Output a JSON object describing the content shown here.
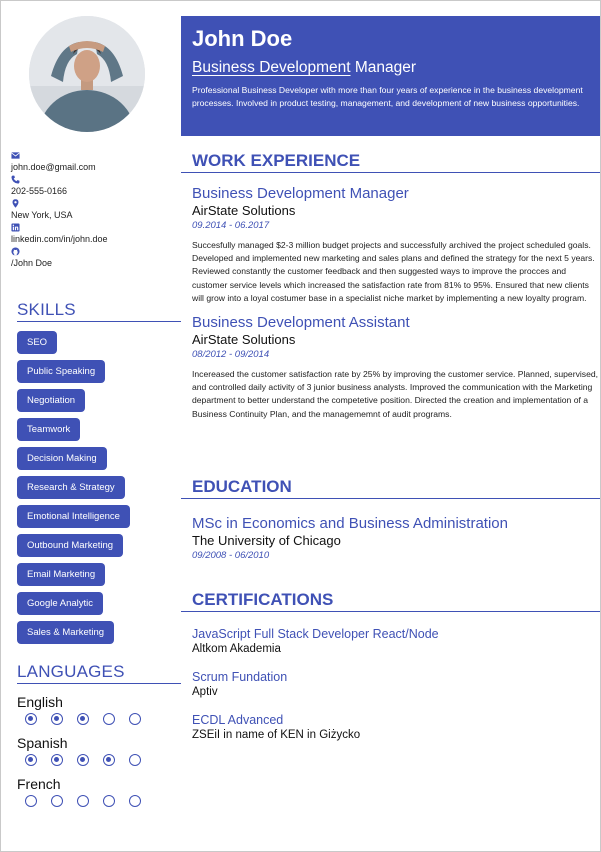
{
  "profile": {
    "name": "John Doe",
    "role_underlined": "Business Development",
    "role_rest": " Manager",
    "summary": "Professional Business Developer with more than four years of experience in the business development processes. Involved in product testing, management, and development of new business opportunities."
  },
  "contacts": [
    {
      "icon": "envelope-icon",
      "text": "john.doe@gmail.com"
    },
    {
      "icon": "phone-icon",
      "text": "202-555-0166"
    },
    {
      "icon": "location-pin-icon",
      "text": "New York, USA"
    },
    {
      "icon": "linkedin-icon",
      "text": "linkedin.com/in/john.doe"
    },
    {
      "icon": "github-icon",
      "text": "/John Doe"
    }
  ],
  "skills": {
    "heading": "SKILLS",
    "items": [
      "SEO",
      "Public Speaking",
      "Negotiation",
      "Teamwork",
      "Decision Making",
      "Research & Strategy",
      "Emotional Intelligence",
      "Outbound Marketing",
      "Email Marketing",
      "Google Analytic",
      "Sales & Marketing"
    ]
  },
  "languages": {
    "heading": "LANGUAGES",
    "items": [
      {
        "name": "English",
        "level": 3,
        "max": 5
      },
      {
        "name": "Spanish",
        "level": 4,
        "max": 5
      },
      {
        "name": "French",
        "level": 0,
        "max": 5
      }
    ]
  },
  "work": {
    "heading": "WORK EXPERIENCE",
    "jobs": [
      {
        "title": "Business Development Manager",
        "company": "AirState Solutions",
        "dates": "09.2014 - 06.2017",
        "description": "Succesfully managed $2-3 million budget projects and successfully archived the project scheduled goals. Developed and implemented new marketing and sales plans and defined the strategy for the next 5 years. Reviewed constantly the customer feedback and then suggested ways to improve the procces and customer service levels which increased the satisfaction rate from 81% to 95%. Ensured that new clients will grow into a loyal costumer base in a specialist niche market by implementing a new loyalty program."
      },
      {
        "title": "Business Development Assistant",
        "company": "AirState Solutions",
        "dates": "08/2012 - 09/2014",
        "description": "Incereased the customer satisfaction rate by 25% by improving the customer service. Planned, supervised, and controlled daily activity of 3 junior business analysts. Improved the communication with the Marketing department to better understand the competetive position. Directed the creation and implementation of a Business Continuity Plan, and the managememnt of audit programs."
      }
    ]
  },
  "education": {
    "heading": "EDUCATION",
    "items": [
      {
        "degree": "MSc in Economics and Business Administration",
        "school": "The University of Chicago",
        "dates": "09/2008 - 06/2010"
      }
    ]
  },
  "certifications": {
    "heading": "CERTIFICATIONS",
    "items": [
      {
        "name": "JavaScript Full Stack Developer React/Node",
        "issuer": "Altkom Akademia"
      },
      {
        "name": "Scrum Fundation",
        "issuer": "Aptiv"
      },
      {
        "name": "ECDL Advanced",
        "issuer": "ZSEiI in name of KEN in Giżycko"
      }
    ]
  },
  "colors": {
    "accent": "#3f51b5"
  }
}
